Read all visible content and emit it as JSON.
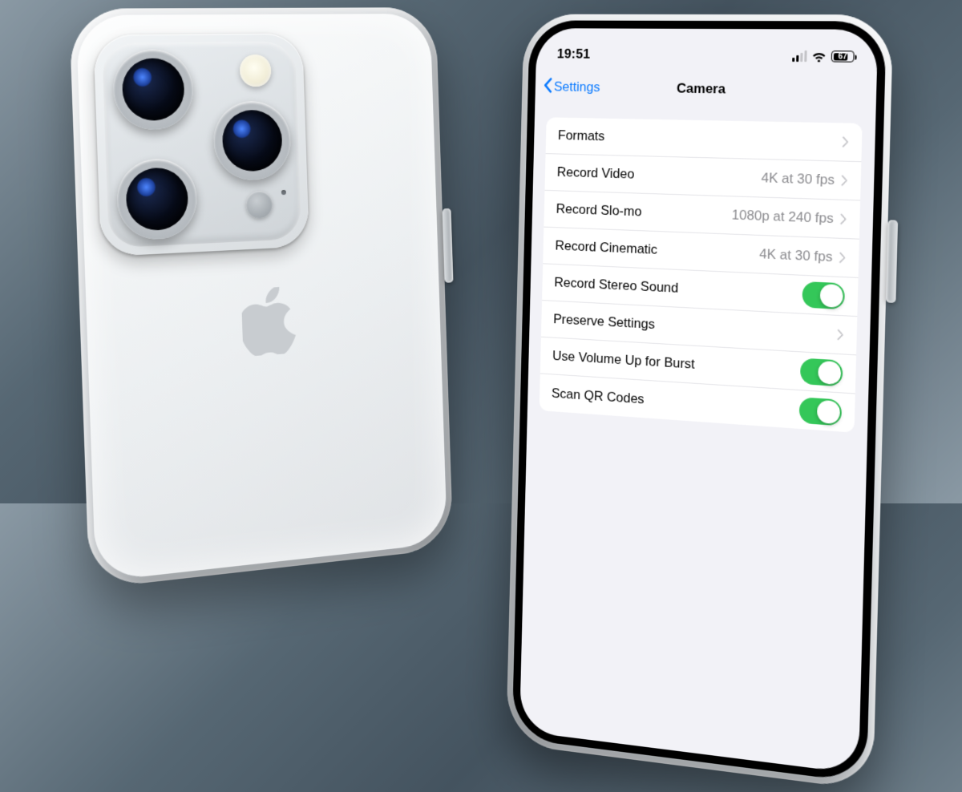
{
  "status": {
    "time": "19:51",
    "battery_pct": "67"
  },
  "nav": {
    "back_label": "Settings",
    "title": "Camera"
  },
  "rows": [
    {
      "label": "Formats",
      "value": "",
      "kind": "chevron"
    },
    {
      "label": "Record Video",
      "value": "4K at 30 fps",
      "kind": "chevron"
    },
    {
      "label": "Record Slo-mo",
      "value": "1080p at 240 fps",
      "kind": "chevron"
    },
    {
      "label": "Record Cinematic",
      "value": "4K at 30 fps",
      "kind": "chevron"
    },
    {
      "label": "Record Stereo Sound",
      "value": "",
      "kind": "toggle-on"
    },
    {
      "label": "Preserve Settings",
      "value": "",
      "kind": "chevron"
    },
    {
      "label": "Use Volume Up for Burst",
      "value": "",
      "kind": "toggle-on"
    },
    {
      "label": "Scan QR Codes",
      "value": "",
      "kind": "toggle-on"
    }
  ]
}
